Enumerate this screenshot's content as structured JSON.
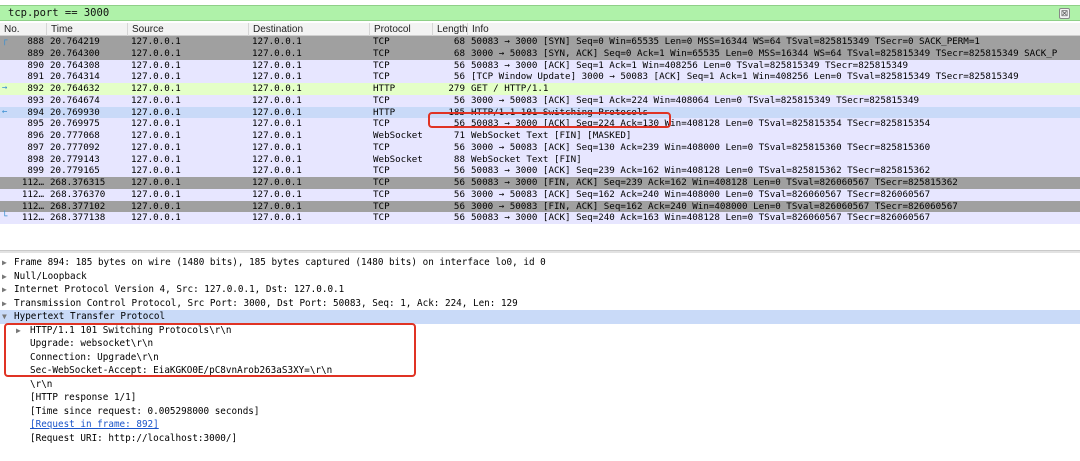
{
  "filter": {
    "value": "tcp.port == 3000",
    "clear_label": "⊠"
  },
  "columns": [
    "No.",
    "Time",
    "Source",
    "Destination",
    "Protocol",
    "Length",
    "Info"
  ],
  "packets": [
    {
      "no": "888",
      "time": "20.764219",
      "src": "127.0.0.1",
      "dst": "127.0.0.1",
      "proto": "TCP",
      "len": "68",
      "info": "50083 → 3000 [SYN] Seq=0 Win=65535 Len=0 MSS=16344 WS=64 TSval=825815349 TSecr=0 SACK_PERM=1",
      "style": "tcp-dark",
      "marker": "┌"
    },
    {
      "no": "889",
      "time": "20.764300",
      "src": "127.0.0.1",
      "dst": "127.0.0.1",
      "proto": "TCP",
      "len": "68",
      "info": "3000 → 50083 [SYN, ACK] Seq=0 Ack=1 Win=65535 Len=0 MSS=16344 WS=64 TSval=825815349 TSecr=825815349 SACK_P",
      "style": "tcp-dark",
      "marker": ""
    },
    {
      "no": "890",
      "time": "20.764308",
      "src": "127.0.0.1",
      "dst": "127.0.0.1",
      "proto": "TCP",
      "len": "56",
      "info": "50083 → 3000 [ACK] Seq=1 Ack=1 Win=408256 Len=0 TSval=825815349 TSecr=825815349",
      "style": "tcp",
      "marker": ""
    },
    {
      "no": "891",
      "time": "20.764314",
      "src": "127.0.0.1",
      "dst": "127.0.0.1",
      "proto": "TCP",
      "len": "56",
      "info": "[TCP Window Update] 3000 → 50083 [ACK] Seq=1 Ack=1 Win=408256 Len=0 TSval=825815349 TSecr=825815349",
      "style": "tcp",
      "marker": ""
    },
    {
      "no": "892",
      "time": "20.764632",
      "src": "127.0.0.1",
      "dst": "127.0.0.1",
      "proto": "HTTP",
      "len": "279",
      "info": "GET / HTTP/1.1",
      "style": "http",
      "marker": "→"
    },
    {
      "no": "893",
      "time": "20.764674",
      "src": "127.0.0.1",
      "dst": "127.0.0.1",
      "proto": "TCP",
      "len": "56",
      "info": "3000 → 50083 [ACK] Seq=1 Ack=224 Win=408064 Len=0 TSval=825815349 TSecr=825815349",
      "style": "tcp",
      "marker": ""
    },
    {
      "no": "894",
      "time": "20.769930",
      "src": "127.0.0.1",
      "dst": "127.0.0.1",
      "proto": "HTTP",
      "len": "185",
      "info": "HTTP/1.1 101 Switching Protocols",
      "style": "selected",
      "marker": "←"
    },
    {
      "no": "895",
      "time": "20.769975",
      "src": "127.0.0.1",
      "dst": "127.0.0.1",
      "proto": "TCP",
      "len": "56",
      "info": "50083 → 3000 [ACK] Seq=224 Ack=130 Win=408128 Len=0 TSval=825815354 TSecr=825815354",
      "style": "tcp",
      "marker": ""
    },
    {
      "no": "896",
      "time": "20.777068",
      "src": "127.0.0.1",
      "dst": "127.0.0.1",
      "proto": "WebSocket",
      "len": "71",
      "info": "WebSocket Text [FIN] [MASKED]",
      "style": "ws",
      "marker": ""
    },
    {
      "no": "897",
      "time": "20.777092",
      "src": "127.0.0.1",
      "dst": "127.0.0.1",
      "proto": "TCP",
      "len": "56",
      "info": "3000 → 50083 [ACK] Seq=130 Ack=239 Win=408000 Len=0 TSval=825815360 TSecr=825815360",
      "style": "tcp",
      "marker": ""
    },
    {
      "no": "898",
      "time": "20.779143",
      "src": "127.0.0.1",
      "dst": "127.0.0.1",
      "proto": "WebSocket",
      "len": "88",
      "info": "WebSocket Text [FIN]",
      "style": "ws",
      "marker": ""
    },
    {
      "no": "899",
      "time": "20.779165",
      "src": "127.0.0.1",
      "dst": "127.0.0.1",
      "proto": "TCP",
      "len": "56",
      "info": "50083 → 3000 [ACK] Seq=239 Ack=162 Win=408128 Len=0 TSval=825815362 TSecr=825815362",
      "style": "tcp",
      "marker": ""
    },
    {
      "no": "112…",
      "time": "268.376315",
      "src": "127.0.0.1",
      "dst": "127.0.0.1",
      "proto": "TCP",
      "len": "56",
      "info": "50083 → 3000 [FIN, ACK] Seq=239 Ack=162 Win=408128 Len=0 TSval=826060567 TSecr=825815362",
      "style": "tcp-dark",
      "marker": ""
    },
    {
      "no": "112…",
      "time": "268.376370",
      "src": "127.0.0.1",
      "dst": "127.0.0.1",
      "proto": "TCP",
      "len": "56",
      "info": "3000 → 50083 [ACK] Seq=162 Ack=240 Win=408000 Len=0 TSval=826060567 TSecr=826060567",
      "style": "tcp",
      "marker": ""
    },
    {
      "no": "112…",
      "time": "268.377102",
      "src": "127.0.0.1",
      "dst": "127.0.0.1",
      "proto": "TCP",
      "len": "56",
      "info": "3000 → 50083 [FIN, ACK] Seq=162 Ack=240 Win=408000 Len=0 TSval=826060567 TSecr=826060567",
      "style": "tcp-dark",
      "marker": ""
    },
    {
      "no": "112…",
      "time": "268.377138",
      "src": "127.0.0.1",
      "dst": "127.0.0.1",
      "proto": "TCP",
      "len": "56",
      "info": "50083 → 3000 [ACK] Seq=240 Ack=163 Win=408128 Len=0 TSval=826060567 TSecr=826060567",
      "style": "tcp",
      "marker": "└"
    }
  ],
  "details": [
    {
      "text": "Frame 894: 185 bytes on wire (1480 bits), 185 bytes captured (1480 bits) on interface lo0, id 0",
      "tri": "▶",
      "level": 0,
      "style": "",
      "link": false
    },
    {
      "text": "Null/Loopback",
      "tri": "▶",
      "level": 0,
      "style": "",
      "link": false
    },
    {
      "text": "Internet Protocol Version 4, Src: 127.0.0.1, Dst: 127.0.0.1",
      "tri": "▶",
      "level": 0,
      "style": "",
      "link": false
    },
    {
      "text": "Transmission Control Protocol, Src Port: 3000, Dst Port: 50083, Seq: 1, Ack: 224, Len: 129",
      "tri": "▶",
      "level": 0,
      "style": "",
      "link": false
    },
    {
      "text": "Hypertext Transfer Protocol",
      "tri": "▼",
      "level": 0,
      "style": "sel",
      "link": false
    },
    {
      "text": "HTTP/1.1 101 Switching Protocols\\r\\n",
      "tri": "▶",
      "level": 1,
      "style": "",
      "link": false
    },
    {
      "text": "Upgrade: websocket\\r\\n",
      "tri": "",
      "level": 1,
      "style": "",
      "link": false
    },
    {
      "text": "Connection: Upgrade\\r\\n",
      "tri": "",
      "level": 1,
      "style": "",
      "link": false
    },
    {
      "text": "Sec-WebSocket-Accept: EiaKGKO0E/pC8vnArob263aS3XY=\\r\\n",
      "tri": "",
      "level": 1,
      "style": "",
      "link": false
    },
    {
      "text": "\\r\\n",
      "tri": "",
      "level": 1,
      "style": "",
      "link": false
    },
    {
      "text": "[HTTP response 1/1]",
      "tri": "",
      "level": 1,
      "style": "",
      "link": false
    },
    {
      "text": "[Time since request: 0.005298000 seconds]",
      "tri": "",
      "level": 1,
      "style": "",
      "link": false
    },
    {
      "text": "[Request in frame: 892]",
      "tri": "",
      "level": 1,
      "style": "",
      "link": true
    },
    {
      "text": "[Request URI: http://localhost:3000/]",
      "tri": "",
      "level": 1,
      "style": "",
      "link": false
    }
  ]
}
